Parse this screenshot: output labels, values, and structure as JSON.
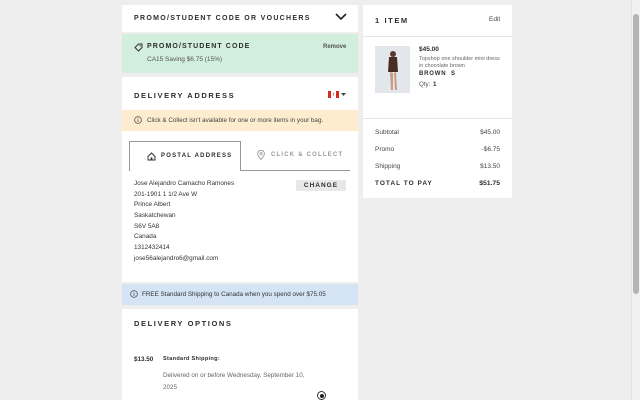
{
  "promo_header": {
    "title": "PROMO/STUDENT CODE OR VOUCHERS"
  },
  "promo_applied": {
    "title": "PROMO/STUDENT CODE",
    "remove_label": "Remove",
    "code": "CA15",
    "saving": "Saving $6.75 (15%)"
  },
  "delivery_address": {
    "title": "DELIVERY ADDRESS",
    "country_flag": "canada-flag",
    "notice": "Click & Collect isn't available for one or more items in your bag.",
    "tabs": [
      {
        "label": "POSTAL ADDRESS",
        "icon": "home-icon"
      },
      {
        "label": "CLICK & COLLECT",
        "icon": "location-pin-icon"
      }
    ],
    "change_label": "CHANGE",
    "lines": [
      "Jose Alejandro Camacho Ramones",
      "201-1901 1 1/2 Ave W",
      "Prince Albert",
      "Saskatchewan",
      "S6V 5A8",
      "Canada",
      "1312432414",
      "jose56alejandro6@gmail.com"
    ]
  },
  "shipping_banner": {
    "text": "FREE Standard Shipping to Canada when you spend over $75.05"
  },
  "delivery_options": {
    "title": "DELIVERY OPTIONS",
    "price": "$13.50",
    "method": "Standard Shipping:",
    "eta": "Delivered on or before Wednesday, September 10,",
    "eta_year": "2025"
  },
  "summary": {
    "title": "1 ITEM",
    "edit_label": "Edit",
    "item": {
      "price": "$45.00",
      "name_line1": "Topshop one shoulder mini dress",
      "name_line2": "in chocolate brown",
      "color": "BROWN",
      "size": "S",
      "qty_label": "Qty:",
      "qty": "1"
    },
    "rows": [
      {
        "label": "Subtotal",
        "value": "$45.00"
      },
      {
        "label": "Promo",
        "value": "-$6.75"
      },
      {
        "label": "Shipping",
        "value": "$13.50"
      }
    ],
    "total_label": "TOTAL TO PAY",
    "total_value": "$51.75"
  },
  "colors": {
    "promo_bg": "#d2eedd",
    "notice_bg": "#fdeccd",
    "info_bg": "#d4e4f5",
    "page_bg": "#eeeeee"
  }
}
